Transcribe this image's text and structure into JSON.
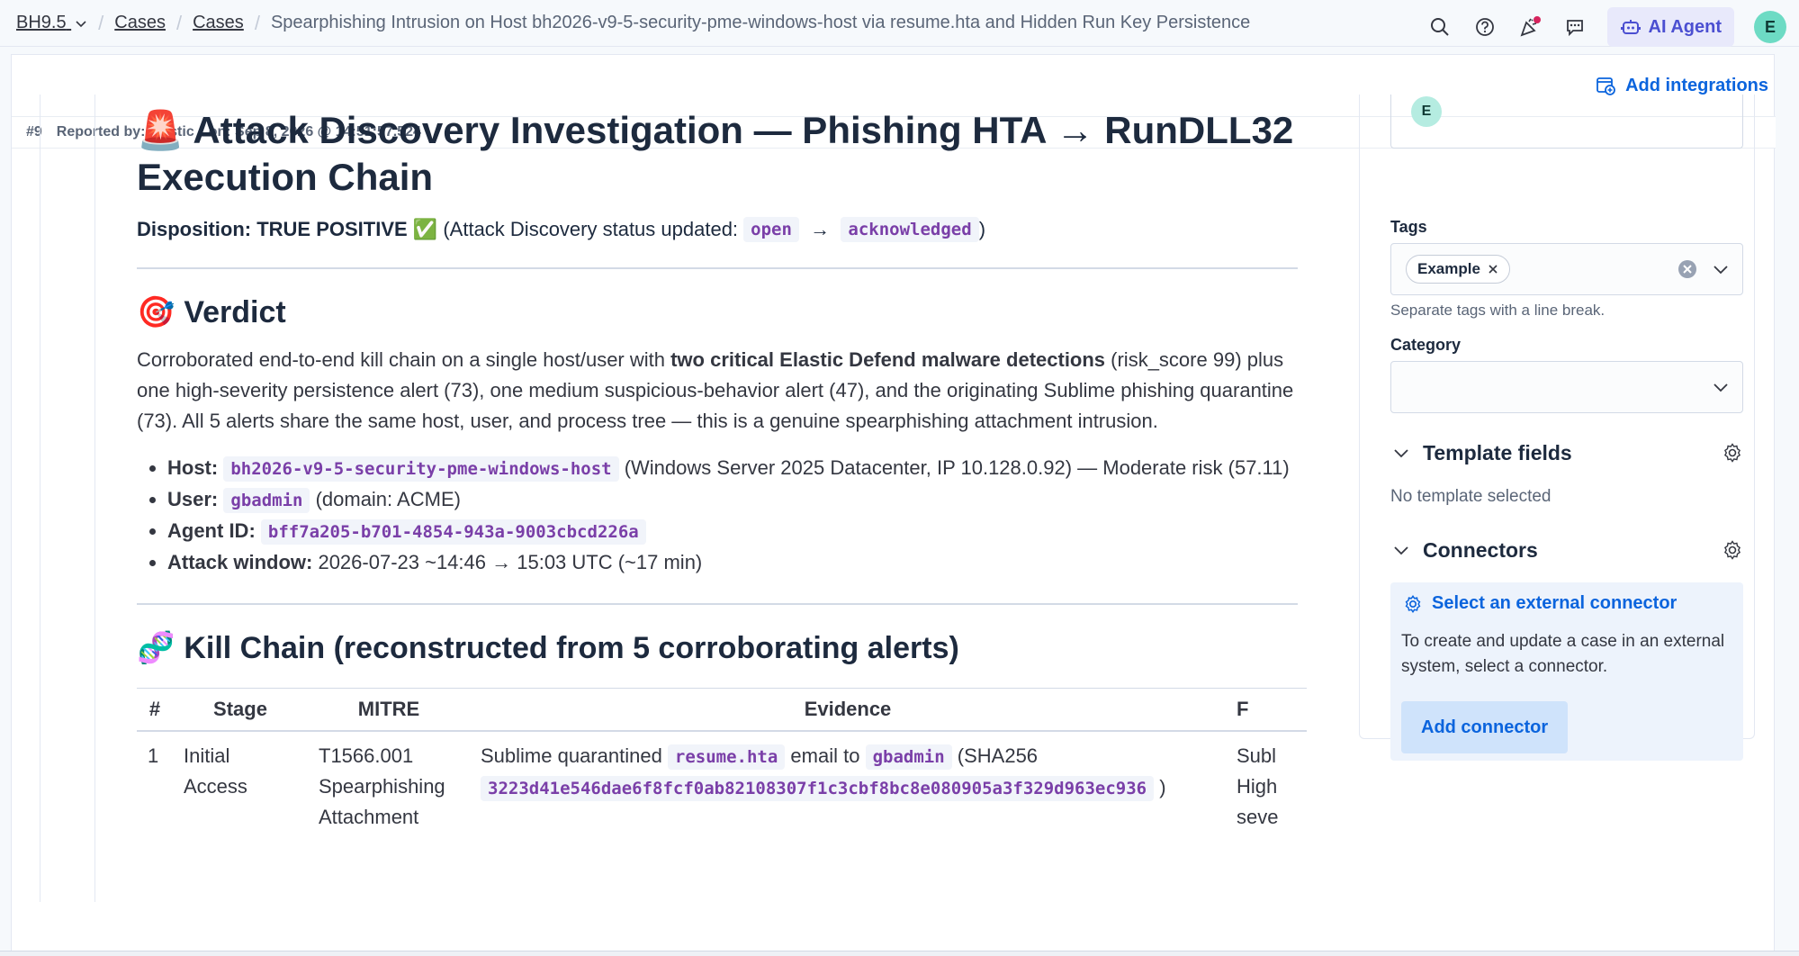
{
  "breadcrumbs": {
    "space": "BH9.5",
    "cases1": "Cases",
    "cases2": "Cases",
    "current": "Spearphishing Intrusion on Host bh2026-v9-5-security-pme-windows-host via resume.hta and Hidden Run Key Persistence"
  },
  "topbar": {
    "ai_agent_label": "AI Agent",
    "user_initial": "E"
  },
  "header": {
    "add_integrations": "Add integrations"
  },
  "meta": {
    "case_number": "#9",
    "reported_by": "Reported by: elastic",
    "reported_on": "on: Sep 8, 2026 @ 14:51:57.524"
  },
  "content": {
    "title_emoji": "🚨",
    "title": "Attack Discovery Investigation — Phishing HTA → RunDLL32 Execution Chain",
    "disposition_bold": "Disposition: TRUE POSITIVE",
    "disposition_check": "✅",
    "disposition_text": "(Attack Discovery status updated:",
    "status_from": "open",
    "arrow": "→",
    "status_to": "acknowledged",
    "close_paren": ")",
    "verdict_emoji": "🎯",
    "verdict_heading": "Verdict",
    "verdict_p1": "Corroborated end-to-end kill chain on a single host/user with ",
    "verdict_p_bold": "two critical Elastic Defend malware detections",
    "verdict_p2": " (risk_score 99) plus one high-severity persistence alert (73), one medium suspicious-behavior alert (47), and the originating Sublime phishing quarantine (73). All 5 alerts share the same host, user, and process tree — this is a genuine spearphishing attachment intrusion.",
    "bullets": {
      "host_label": "Host:",
      "host_value": "bh2026-v9-5-security-pme-windows-host",
      "host_rest": " (Windows Server 2025 Datacenter, IP 10.128.0.92) — Moderate risk (57.11)",
      "user_label": "User:",
      "user_value": "gbadmin",
      "user_rest": " (domain: ACME)",
      "agent_label": "Agent ID:",
      "agent_value": "bff7a205-b701-4854-943a-9003cbcd226a",
      "window_label": "Attack window:",
      "window_rest": " 2026-07-23 ~14:46 → 15:03 UTC (~17 min)"
    },
    "kill_emoji": "🧬",
    "kill_heading": "Kill Chain (reconstructed from 5 corroborating alerts)",
    "table": {
      "headers": [
        "#",
        "Stage",
        "MITRE",
        "Evidence",
        "F"
      ],
      "row1": {
        "num": "1",
        "stage": "Initial Access",
        "mitre_line1": "T1566.001",
        "mitre_line2": "Spearphishing",
        "mitre_line3": "Attachment",
        "ev_text1": "Sublime quarantined ",
        "ev_code1": "resume.hta",
        "ev_text2": " email to ",
        "ev_code2": "gbadmin",
        "ev_text3": " (SHA256",
        "ev_hash": "3223d41e546dae6f8fcf0ab82108307f1c3cbf8bc8e080905a3f329d963ec936",
        "ev_text4": ")",
        "f_line1": "Subl",
        "f_line2": "High",
        "f_line3": "seve"
      }
    }
  },
  "sidebar": {
    "assignee_initial": "E",
    "tags_label": "Tags",
    "tag_value": "Example",
    "tags_help": "Separate tags with a line break.",
    "category_label": "Category",
    "template_fields": "Template fields",
    "no_template": "No template selected",
    "connectors": "Connectors",
    "select_connector": "Select an external connector",
    "connector_text": "To create and update a case in an external system, select a connector.",
    "add_connector": "Add connector"
  }
}
